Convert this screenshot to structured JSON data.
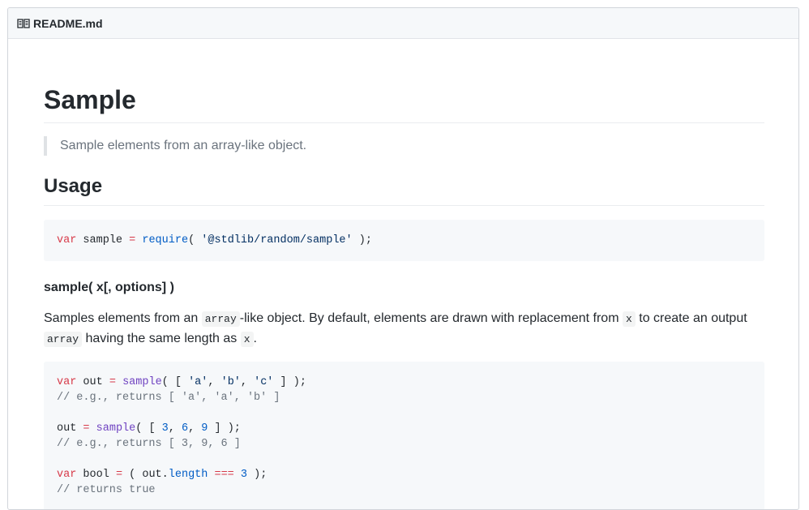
{
  "header": {
    "filename": "README.md",
    "icon": "book-icon"
  },
  "title": "Sample",
  "description": "Sample elements from an array-like object.",
  "usage_heading": "Usage",
  "require_code": {
    "kw": "var",
    "name": "sample",
    "op": "=",
    "fn": "require",
    "open": "(",
    "str": "'@stdlib/random/sample'",
    "close": ");"
  },
  "signature": "sample( x[, options] )",
  "paragraph": {
    "t1": "Samples elements from an ",
    "c1": "array",
    "t2": "-like object. By default, elements are drawn with replacement from ",
    "c2": "x",
    "t3": " to create an output ",
    "c3": "array",
    "t4": " having the same length as ",
    "c4": "x",
    "t5": "."
  },
  "example": {
    "l1": {
      "kw": "var",
      "v": "out",
      "op": "=",
      "fn": "sample",
      "a": "( [ ",
      "s1": "'a'",
      "s2": "'b'",
      "s3": "'c'",
      "b": " ] );"
    },
    "l2": "// e.g., returns [ 'a', 'a', 'b' ]",
    "l3": {
      "v": "out",
      "op": "=",
      "fn": "sample",
      "a": "( [ ",
      "n1": "3",
      "n2": "6",
      "n3": "9",
      "b": " ] );"
    },
    "l4": "// e.g., returns [ 3, 9, 6 ]",
    "l5": {
      "kw": "var",
      "v": "bool",
      "op": "=",
      "a": "( out.",
      "prop": "length",
      "eq": "===",
      "n": "3",
      "b": " );"
    },
    "l6": "// returns true"
  }
}
